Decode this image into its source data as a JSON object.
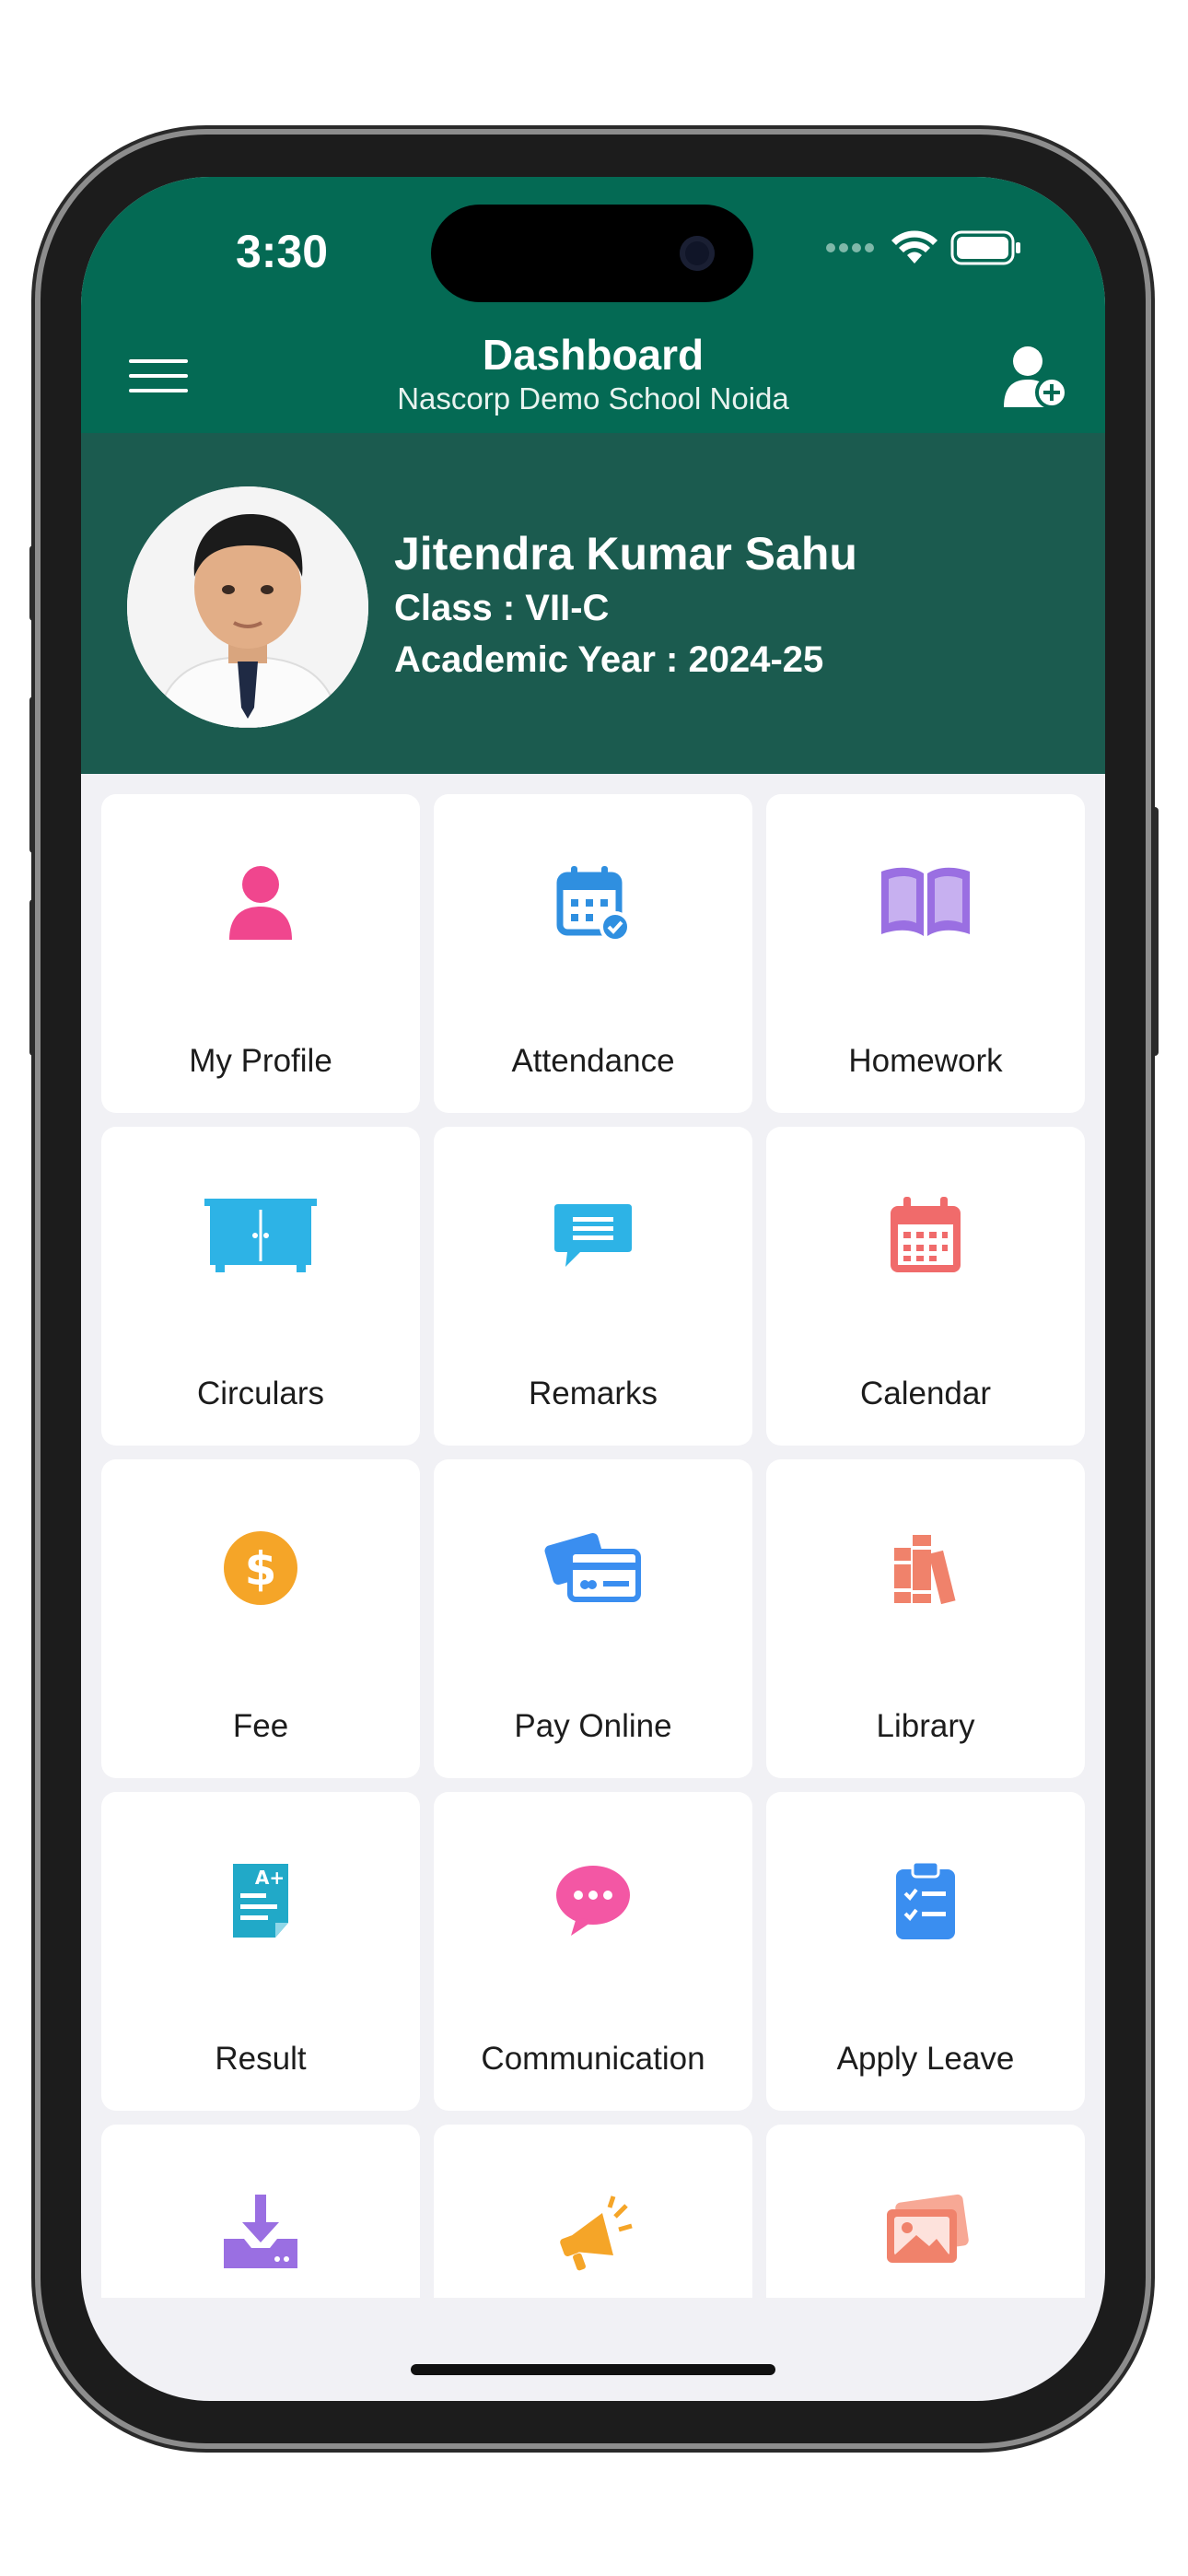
{
  "status_bar": {
    "time": "3:30"
  },
  "header": {
    "title": "Dashboard",
    "subtitle": "Nascorp Demo School Noida"
  },
  "profile": {
    "name": "Jitendra Kumar Sahu",
    "class_line": "Class : VII-C",
    "year_line": "Academic Year : 2024-25"
  },
  "tiles": [
    {
      "label": "My Profile",
      "icon": "user-icon",
      "color": "#f0468e"
    },
    {
      "label": "Attendance",
      "icon": "calendar-check-icon",
      "color": "#2f8fe0"
    },
    {
      "label": "Homework",
      "icon": "book-icon",
      "color": "#9a6fe2"
    },
    {
      "label": "Circulars",
      "icon": "cupboard-icon",
      "color": "#2db3e6"
    },
    {
      "label": "Remarks",
      "icon": "chat-icon",
      "color": "#2db3e6"
    },
    {
      "label": "Calendar",
      "icon": "calendar-icon",
      "color": "#f06b6b"
    },
    {
      "label": "Fee",
      "icon": "dollar-icon",
      "color": "#f5a528"
    },
    {
      "label": "Pay Online",
      "icon": "credit-card-icon",
      "color": "#3a8ef0"
    },
    {
      "label": "Library",
      "icon": "books-icon",
      "color": "#f0826b"
    },
    {
      "label": "Result",
      "icon": "result-icon",
      "color": "#21a9c8"
    },
    {
      "label": "Communication",
      "icon": "chat-bubble-icon",
      "color": "#f357a4"
    },
    {
      "label": "Apply Leave",
      "icon": "clipboard-icon",
      "color": "#3a8ef0"
    },
    {
      "label": "",
      "icon": "download-icon",
      "color": "#9a6fe2"
    },
    {
      "label": "",
      "icon": "megaphone-icon",
      "color": "#f5a528"
    },
    {
      "label": "",
      "icon": "gallery-icon",
      "color": "#f0826b"
    }
  ]
}
